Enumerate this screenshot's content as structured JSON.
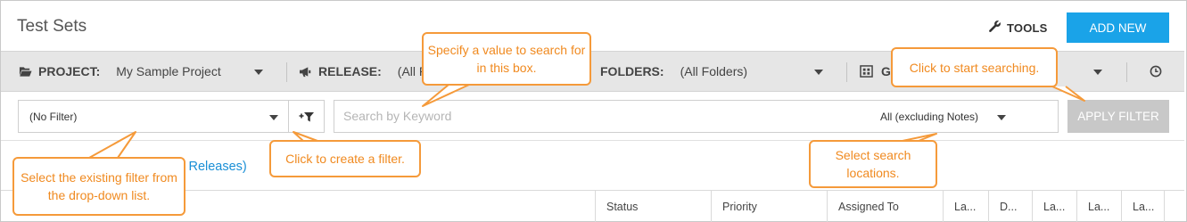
{
  "header": {
    "title": "Test Sets",
    "tools_label": "TOOLS",
    "add_new_label": "ADD NEW"
  },
  "context": {
    "project_label": "PROJECT:",
    "project_value": "My Sample Project",
    "release_label": "RELEASE:",
    "release_value": "(All Re",
    "release_value_tail": ")",
    "folders_label": "FOLDERS:",
    "folders_value": "(All Folders)",
    "group_label": "G"
  },
  "filter": {
    "selected": "(No Filter)",
    "search_placeholder": "Search by Keyword",
    "search_value": "",
    "scope": "All (excluding Notes)",
    "apply_label": "APPLY FILTER"
  },
  "release_link_text": "ll Releases)",
  "table": {
    "columns": [
      "Status",
      "Priority",
      "Assigned To",
      "La...",
      "D...",
      "La...",
      "La...",
      "La..."
    ]
  },
  "callouts": {
    "search_value": "Specify a value to search for in this box.",
    "start_search": "Click to start searching.",
    "existing_filter": "Select the existing filter from the drop-down list.",
    "create_filter": "Click to create a filter.",
    "search_locations": "Select search locations."
  },
  "colors": {
    "accent": "#1aa3e8",
    "callout": "#f59a3a",
    "link": "#1a8fd6",
    "disabled_button": "#c8c8c8"
  }
}
